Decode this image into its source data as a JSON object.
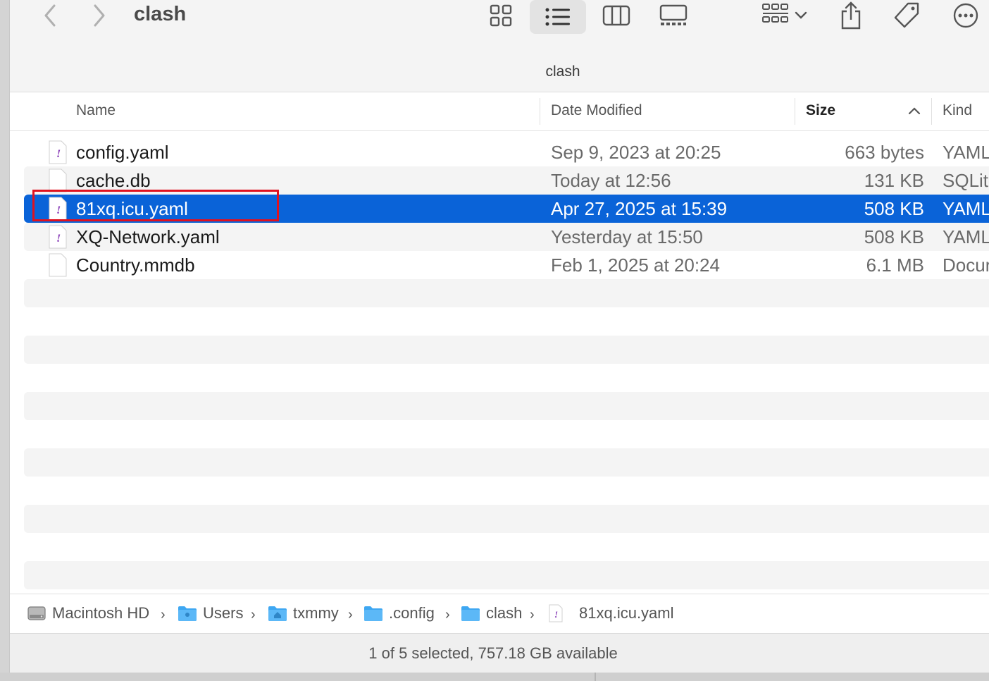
{
  "window": {
    "title": "clash",
    "path_title": "clash"
  },
  "toolbar": {
    "back": "chevron-left-icon",
    "forward": "chevron-right-icon",
    "views": [
      "icon-view",
      "list-view",
      "column-view",
      "gallery-view"
    ],
    "active_view": "list-view"
  },
  "columns": {
    "name": "Name",
    "date": "Date Modified",
    "size": "Size",
    "kind": "Kind",
    "sort_column": "Size",
    "sort_direction": "ascending"
  },
  "files": [
    {
      "name": "config.yaml",
      "date": "Sep 9, 2023 at 20:25",
      "size": "663 bytes",
      "kind": "YAML",
      "icon": "yaml-file-icon"
    },
    {
      "name": "cache.db",
      "date": "Today at 12:56",
      "size": "131 KB",
      "kind": "SQLit",
      "icon": "blank-file-icon"
    },
    {
      "name": "81xq.icu.yaml",
      "date": "Apr 27, 2025 at 15:39",
      "size": "508 KB",
      "kind": "YAML",
      "icon": "yaml-file-icon",
      "selected": true
    },
    {
      "name": "XQ-Network.yaml",
      "date": "Yesterday at 15:50",
      "size": "508 KB",
      "kind": "YAML",
      "icon": "yaml-file-icon"
    },
    {
      "name": "Country.mmdb",
      "date": "Feb 1, 2025 at 20:24",
      "size": "6.1 MB",
      "kind": "Docur",
      "icon": "blank-file-icon"
    }
  ],
  "pathbar": [
    {
      "label": "Macintosh HD",
      "icon": "hard-drive-icon"
    },
    {
      "label": "Users",
      "icon": "folder-icon"
    },
    {
      "label": "txmmy",
      "icon": "home-folder-icon"
    },
    {
      "label": ".config",
      "icon": "folder-icon"
    },
    {
      "label": "clash",
      "icon": "folder-icon"
    },
    {
      "label": "81xq.icu.yaml",
      "icon": "yaml-file-icon"
    }
  ],
  "status": {
    "text": "1 of 5 selected, 757.18 GB available"
  },
  "colors": {
    "selection": "#0a63d8",
    "highlight_box": "#e0121f",
    "folder": "#3ea7f2"
  }
}
